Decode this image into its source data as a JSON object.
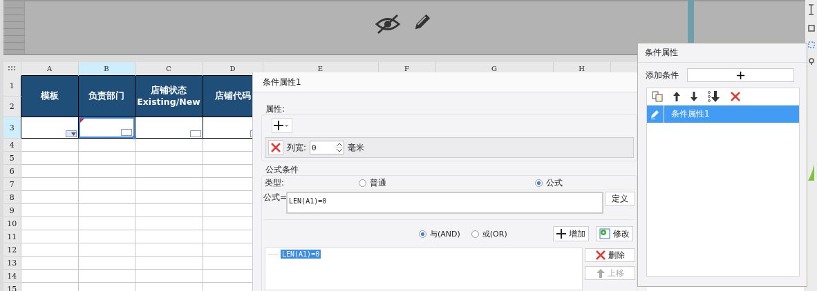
{
  "columns": [
    {
      "label": "A",
      "selected": false
    },
    {
      "label": "B",
      "selected": true
    },
    {
      "label": "C",
      "selected": false
    },
    {
      "label": "D",
      "selected": false
    },
    {
      "label": "E",
      "selected": false
    },
    {
      "label": "F",
      "selected": false
    },
    {
      "label": "G",
      "selected": false
    },
    {
      "label": "H",
      "selected": false
    }
  ],
  "row_numbers": [
    {
      "label": "1",
      "selected": false
    },
    {
      "label": "2",
      "selected": false
    },
    {
      "label": "3",
      "selected": true
    },
    {
      "label": "4",
      "selected": false
    },
    {
      "label": "5",
      "selected": false
    },
    {
      "label": "6",
      "selected": false
    },
    {
      "label": "7",
      "selected": false
    },
    {
      "label": "8",
      "selected": false
    },
    {
      "label": "9",
      "selected": false
    },
    {
      "label": "10",
      "selected": false
    },
    {
      "label": "11",
      "selected": false
    },
    {
      "label": "12",
      "selected": false
    },
    {
      "label": "13",
      "selected": false
    },
    {
      "label": "14",
      "selected": false
    },
    {
      "label": "15",
      "selected": false
    }
  ],
  "headers": [
    "模板",
    "负责部门",
    "店铺状态\nExisting/New",
    "店铺代码"
  ],
  "row3": [
    {
      "kind": "dropdown",
      "selected": false,
      "flagged": false
    },
    {
      "kind": "box",
      "selected": true,
      "flagged": true
    },
    {
      "kind": "box",
      "selected": false,
      "flagged": false
    },
    {
      "kind": "box",
      "selected": false,
      "flagged": false
    }
  ],
  "condition_dialog": {
    "title": "条件属性1",
    "attributes_legend": "属性:",
    "attribute_rows": [
      {
        "label": "列宽:",
        "value": "0",
        "unit": "毫米"
      }
    ],
    "formula_legend": "公式条件",
    "type_label": "类型:",
    "types": [
      {
        "label": "普通",
        "selected": false
      },
      {
        "label": "公式",
        "selected": true
      }
    ],
    "formula_label": "公式=",
    "formula": "LEN(A1)=0",
    "define_button": "定义",
    "logic": [
      {
        "label": "与(AND)",
        "selected": true
      },
      {
        "label": "或(OR)",
        "selected": false
      }
    ],
    "add_button": "增加",
    "modify_button": "修改",
    "conditions": [
      {
        "text": "LEN(A1)=0",
        "selected": true
      }
    ],
    "delete_button": "删除",
    "up_button": "上移",
    "up_disabled": true
  },
  "properties_panel": {
    "title": "条件属性",
    "add_label": "添加条件",
    "add_button": "+",
    "items": [
      {
        "text": "条件属性1",
        "selected": true
      }
    ]
  }
}
